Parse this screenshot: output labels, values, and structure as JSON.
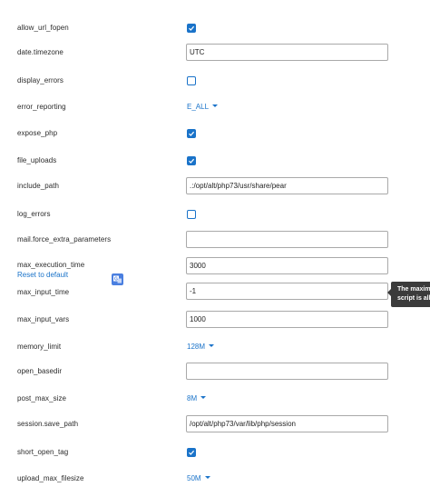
{
  "settings": [
    {
      "key": "allow_url_fopen",
      "type": "checkbox",
      "checked": true
    },
    {
      "key": "date.timezone",
      "type": "text",
      "value": "UTC"
    },
    {
      "key": "display_errors",
      "type": "checkbox",
      "checked": false
    },
    {
      "key": "error_reporting",
      "type": "dropdown",
      "value": "E_ALL"
    },
    {
      "key": "expose_php",
      "type": "checkbox",
      "checked": true
    },
    {
      "key": "file_uploads",
      "type": "checkbox",
      "checked": true
    },
    {
      "key": "include_path",
      "type": "text",
      "value": ".:/opt/alt/php73/usr/share/pear"
    },
    {
      "key": "log_errors",
      "type": "checkbox",
      "checked": false
    },
    {
      "key": "mail.force_extra_parameters",
      "type": "text",
      "value": ""
    },
    {
      "key": "max_execution_time",
      "type": "text",
      "value": "3000",
      "reset_label": "Reset to default"
    },
    {
      "key": "max_input_time",
      "type": "text",
      "value": "-1"
    },
    {
      "key": "max_input_vars",
      "type": "text",
      "value": "1000"
    },
    {
      "key": "memory_limit",
      "type": "dropdown",
      "value": "128M"
    },
    {
      "key": "open_basedir",
      "type": "text",
      "value": ""
    },
    {
      "key": "post_max_size",
      "type": "dropdown",
      "value": "8M"
    },
    {
      "key": "session.save_path",
      "type": "text",
      "value": "/opt/alt/php73/var/lib/php/session"
    },
    {
      "key": "short_open_tag",
      "type": "checkbox",
      "checked": true
    },
    {
      "key": "upload_max_filesize",
      "type": "dropdown",
      "value": "50M"
    }
  ],
  "tooltip": {
    "line1": "The maximu",
    "line2": "script is all"
  },
  "colors": {
    "accent": "#1a73c9",
    "tooltip_bg": "#3b3b3b",
    "input_border": "#a9a9a9"
  },
  "icons": {
    "checkbox": "check-icon",
    "dropdown": "caret-down-icon",
    "translate": "translate-icon"
  }
}
